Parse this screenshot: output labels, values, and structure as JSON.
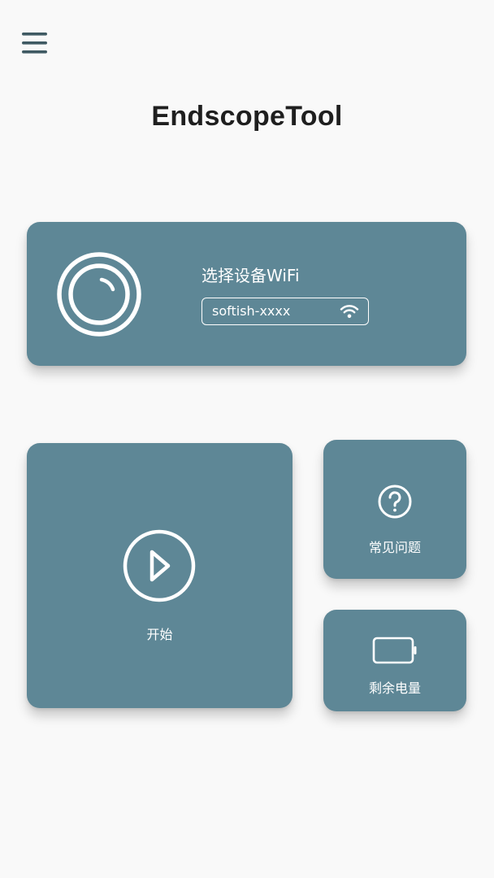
{
  "header": {
    "menu_icon": "hamburger-menu-icon",
    "title": "EndscopeTool"
  },
  "wifi_card": {
    "camera_icon": "camera-lens-icon",
    "label": "选择设备WiFi",
    "ssid": "softish-xxxx",
    "wifi_icon": "wifi-icon"
  },
  "actions": {
    "start": {
      "icon": "play-icon",
      "label": "开始"
    },
    "faq": {
      "icon": "question-icon",
      "label": "常见问题"
    },
    "battery": {
      "icon": "battery-icon",
      "label": "剩余电量"
    }
  },
  "colors": {
    "card": "#5e8796",
    "background": "#f9f9f9",
    "title": "#1f1f1f",
    "menu_icon": "#3f5a63"
  }
}
